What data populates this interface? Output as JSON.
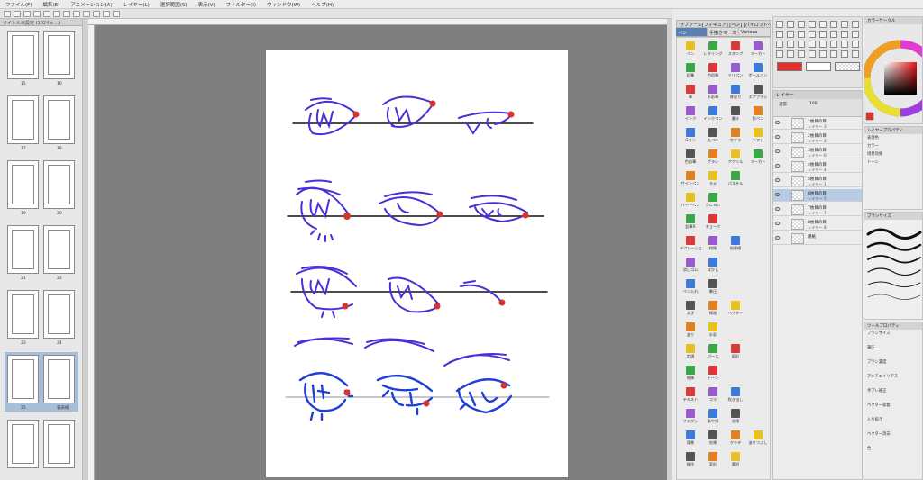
{
  "menu": [
    "ファイル(F)",
    "編集(E)",
    "アニメーション(A)",
    "レイヤー(L)",
    "選択範囲(S)",
    "表示(V)",
    "フィルター(I)",
    "ウィンドウ(W)",
    "ヘルプ(H)"
  ],
  "page_manager": {
    "tab": "タイトル未設定 (1024 x ...)",
    "spreads": [
      {
        "left": "15",
        "right": "16"
      },
      {
        "left": "17",
        "right": "18"
      },
      {
        "left": "19",
        "right": "20"
      },
      {
        "left": "21",
        "right": "22"
      },
      {
        "left": "23",
        "right": "24"
      },
      {
        "left": "25",
        "right": "裏表紙"
      },
      {
        "left": "",
        "right": ""
      }
    ],
    "selected_index": 5
  },
  "subtool": {
    "header": "サブツール[フィギュア]  [ペン]  [パイロットペン]",
    "tabs": [
      "ペン",
      "手描きマーカー",
      "Various"
    ],
    "selected_tab": 0,
    "tools": [
      [
        "ペン",
        "レタリング",
        "スタンプ",
        "マーカー"
      ],
      [
        "鉛筆",
        "色鉛筆",
        "ミリペン",
        "ボールペン"
      ],
      [
        "筆",
        "水彩筆",
        "厚塗り",
        "エアブラシ"
      ],
      [
        "インク",
        "インクペン",
        "墨汁",
        "影ペン"
      ],
      [
        "Gペン",
        "丸ペン",
        "カブラ",
        "ソフト"
      ],
      [
        "色鉛筆",
        "ブラシ",
        "アクリル",
        "マーカー"
      ],
      [
        "サインペン",
        "ラメ",
        "パステル",
        ""
      ],
      [
        "ハードペン",
        "クレヨン",
        "",
        ""
      ],
      [
        "鉛筆R",
        "チョーク",
        "",
        ""
      ],
      [
        "デコレーション",
        "特殊",
        "効果線",
        ""
      ],
      [
        "消しゴム",
        "ぼかし",
        "",
        ""
      ],
      [
        "ペン入れ",
        "筆圧",
        "",
        ""
      ],
      [
        "文字",
        "線画",
        "ベクター",
        ""
      ],
      [
        "塗り",
        "水彩",
        "",
        ""
      ],
      [
        "定規",
        "パース",
        "図形",
        ""
      ],
      [
        "装飾",
        "トーン",
        "",
        ""
      ],
      [
        "テキスト",
        "コマ",
        "吹き出し",
        ""
      ],
      [
        "フキダシ",
        "集中線",
        "流線",
        ""
      ],
      [
        "背景",
        "効果",
        "グラデ",
        "塗りつぶし"
      ],
      [
        "操作",
        "変形",
        "選択",
        ""
      ]
    ]
  },
  "layers": {
    "header": "レイヤー",
    "mode": "通常",
    "opacity": "100",
    "items": [
      {
        "name": "1枚目の目",
        "sub": "レイヤー 3",
        "selected": false
      },
      {
        "name": "2枚目の目",
        "sub": "レイヤー 2",
        "selected": false
      },
      {
        "name": "3枚目の目",
        "sub": "レイヤー 6",
        "selected": false
      },
      {
        "name": "4枚目の目",
        "sub": "レイヤー 4",
        "selected": false
      },
      {
        "name": "5枚目の目",
        "sub": "レイヤー 1",
        "selected": false
      },
      {
        "name": "6枚目の目",
        "sub": "レイヤー 5",
        "selected": true
      },
      {
        "name": "7枚目の目",
        "sub": "レイヤー 7",
        "selected": false
      },
      {
        "name": "8枚目の目",
        "sub": "レイヤー 8",
        "selected": false
      },
      {
        "name": "用紙",
        "sub": "",
        "selected": false
      }
    ]
  },
  "color": {
    "header": "カラーサークル",
    "main": "#e2302a",
    "sub": "#ffffff"
  },
  "props": {
    "header": "レイヤープロパティ",
    "rows": [
      "表現色",
      "カラー",
      "境界効果",
      "トーン"
    ]
  },
  "brush": {
    "header": "ブラシサイズ"
  },
  "toolprop": {
    "header": "ツールプロパティ",
    "rows": [
      "ブラシサイズ",
      "筆圧",
      "ブラシ濃度",
      "アンチエイリアス",
      "手ブレ補正",
      "ベクター吸着",
      "入り抜き",
      "ベクター消去",
      "色"
    ]
  },
  "accent": {
    "stroke": "#4a2fd8",
    "dot": "#d9322a",
    "selection": "#a9bfd9"
  }
}
